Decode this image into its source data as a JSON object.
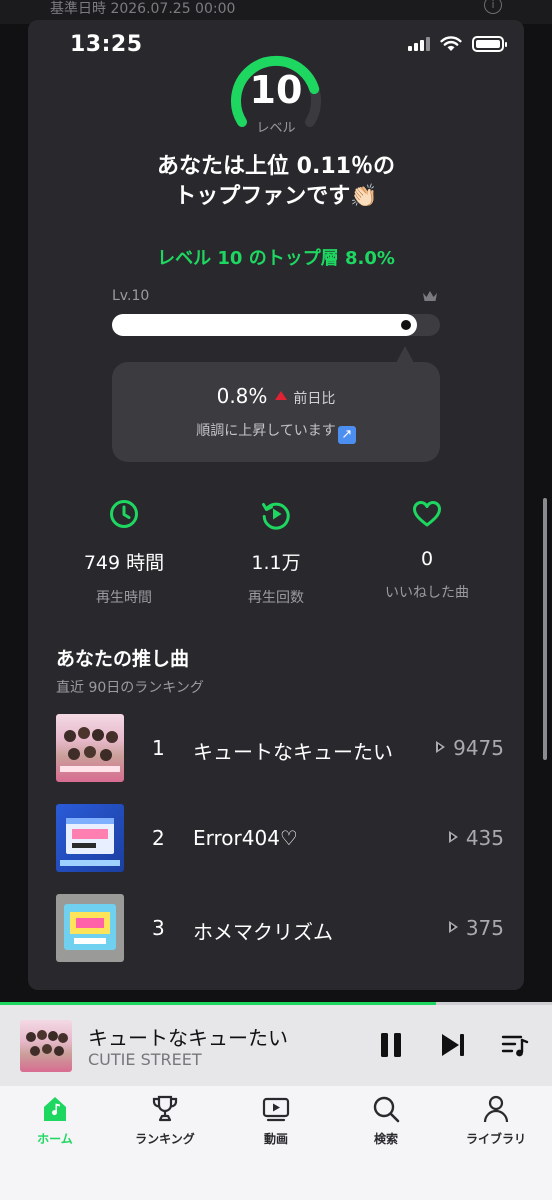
{
  "header": {
    "base_date": "基準日時 2026.07.25 00:00",
    "info_icon": "info-icon"
  },
  "status_bar": {
    "time": "13:25"
  },
  "level": {
    "value": "10",
    "label": "レベル",
    "gauge_fill": 0.8,
    "accent": "#1ed760"
  },
  "headline": {
    "line1": "あなたは上位 0.11％の",
    "line2": "トップファンです👏🏻"
  },
  "tier_text": "レベル 10 のトップ層 8.0%",
  "progress": {
    "level_label": "Lv.10",
    "fill_fraction": 0.93,
    "end_icon": "crown-icon"
  },
  "daily_change": {
    "value": "0.8%",
    "compare_label": "前日比",
    "message": "順調に上昇しています",
    "trend": "up",
    "trend_color": "#e22134"
  },
  "stats": [
    {
      "icon": "clock-icon",
      "value": "749 時間",
      "label": "再生時間"
    },
    {
      "icon": "replay-icon",
      "value": "1.1万",
      "label": "再生回数"
    },
    {
      "icon": "heart-icon",
      "value": "0",
      "label": "いいねした曲"
    }
  ],
  "favorites": {
    "title": "あなたの推し曲",
    "subtitle": "直近 90日のランキング",
    "tracks": [
      {
        "rank": "1",
        "title": "キュートなキューたい",
        "plays": "9475"
      },
      {
        "rank": "2",
        "title": "Error404♡",
        "plays": "435"
      },
      {
        "rank": "3",
        "title": "ホメマクリズム",
        "plays": "375"
      }
    ]
  },
  "now_playing": {
    "title": "キュートなキューたい",
    "artist": "CUTIE STREET",
    "progress": 0.79
  },
  "bottom_nav": [
    {
      "icon": "home-icon",
      "label": "ホーム",
      "active": true
    },
    {
      "icon": "trophy-icon",
      "label": "ランキング"
    },
    {
      "icon": "video-icon",
      "label": "動画"
    },
    {
      "icon": "search-icon",
      "label": "検索"
    },
    {
      "icon": "person-icon",
      "label": "ライブラリ"
    }
  ]
}
